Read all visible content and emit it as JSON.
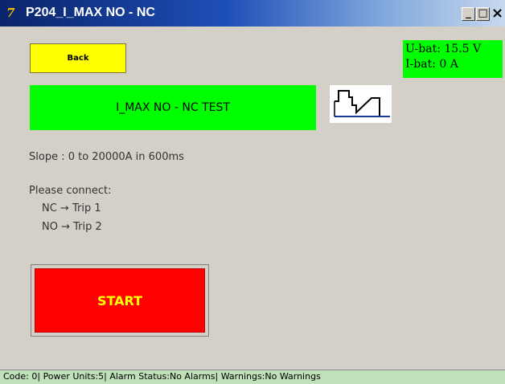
{
  "window": {
    "title": "P204_I_MAX NO - NC",
    "icon": "7",
    "min_label": "_",
    "max_label": "□",
    "close_label": "×"
  },
  "back_button": {
    "label": "Back"
  },
  "battery": {
    "voltage": "U-bat: 15.5 V",
    "current": "I-bat: 0 A"
  },
  "test": {
    "title": "I_MAX NO - NC TEST",
    "icon": "ramp-step-icon"
  },
  "slope_text": "Slope : 0 to 20000A in 600ms",
  "instructions": {
    "heading": "Please connect:",
    "connections": [
      "NC → Trip 1",
      "NO → Trip 2"
    ]
  },
  "start_button": {
    "label": "START"
  },
  "status_bar": "Code: 0| Power Units:5| Alarm Status:No Alarms| Warnings:No Warnings",
  "colors": {
    "accent_green": "#00ff00",
    "back_yellow": "#ffff00",
    "start_red": "#ff0000",
    "start_text": "#ffff00",
    "title_blue": "#0a246a"
  }
}
